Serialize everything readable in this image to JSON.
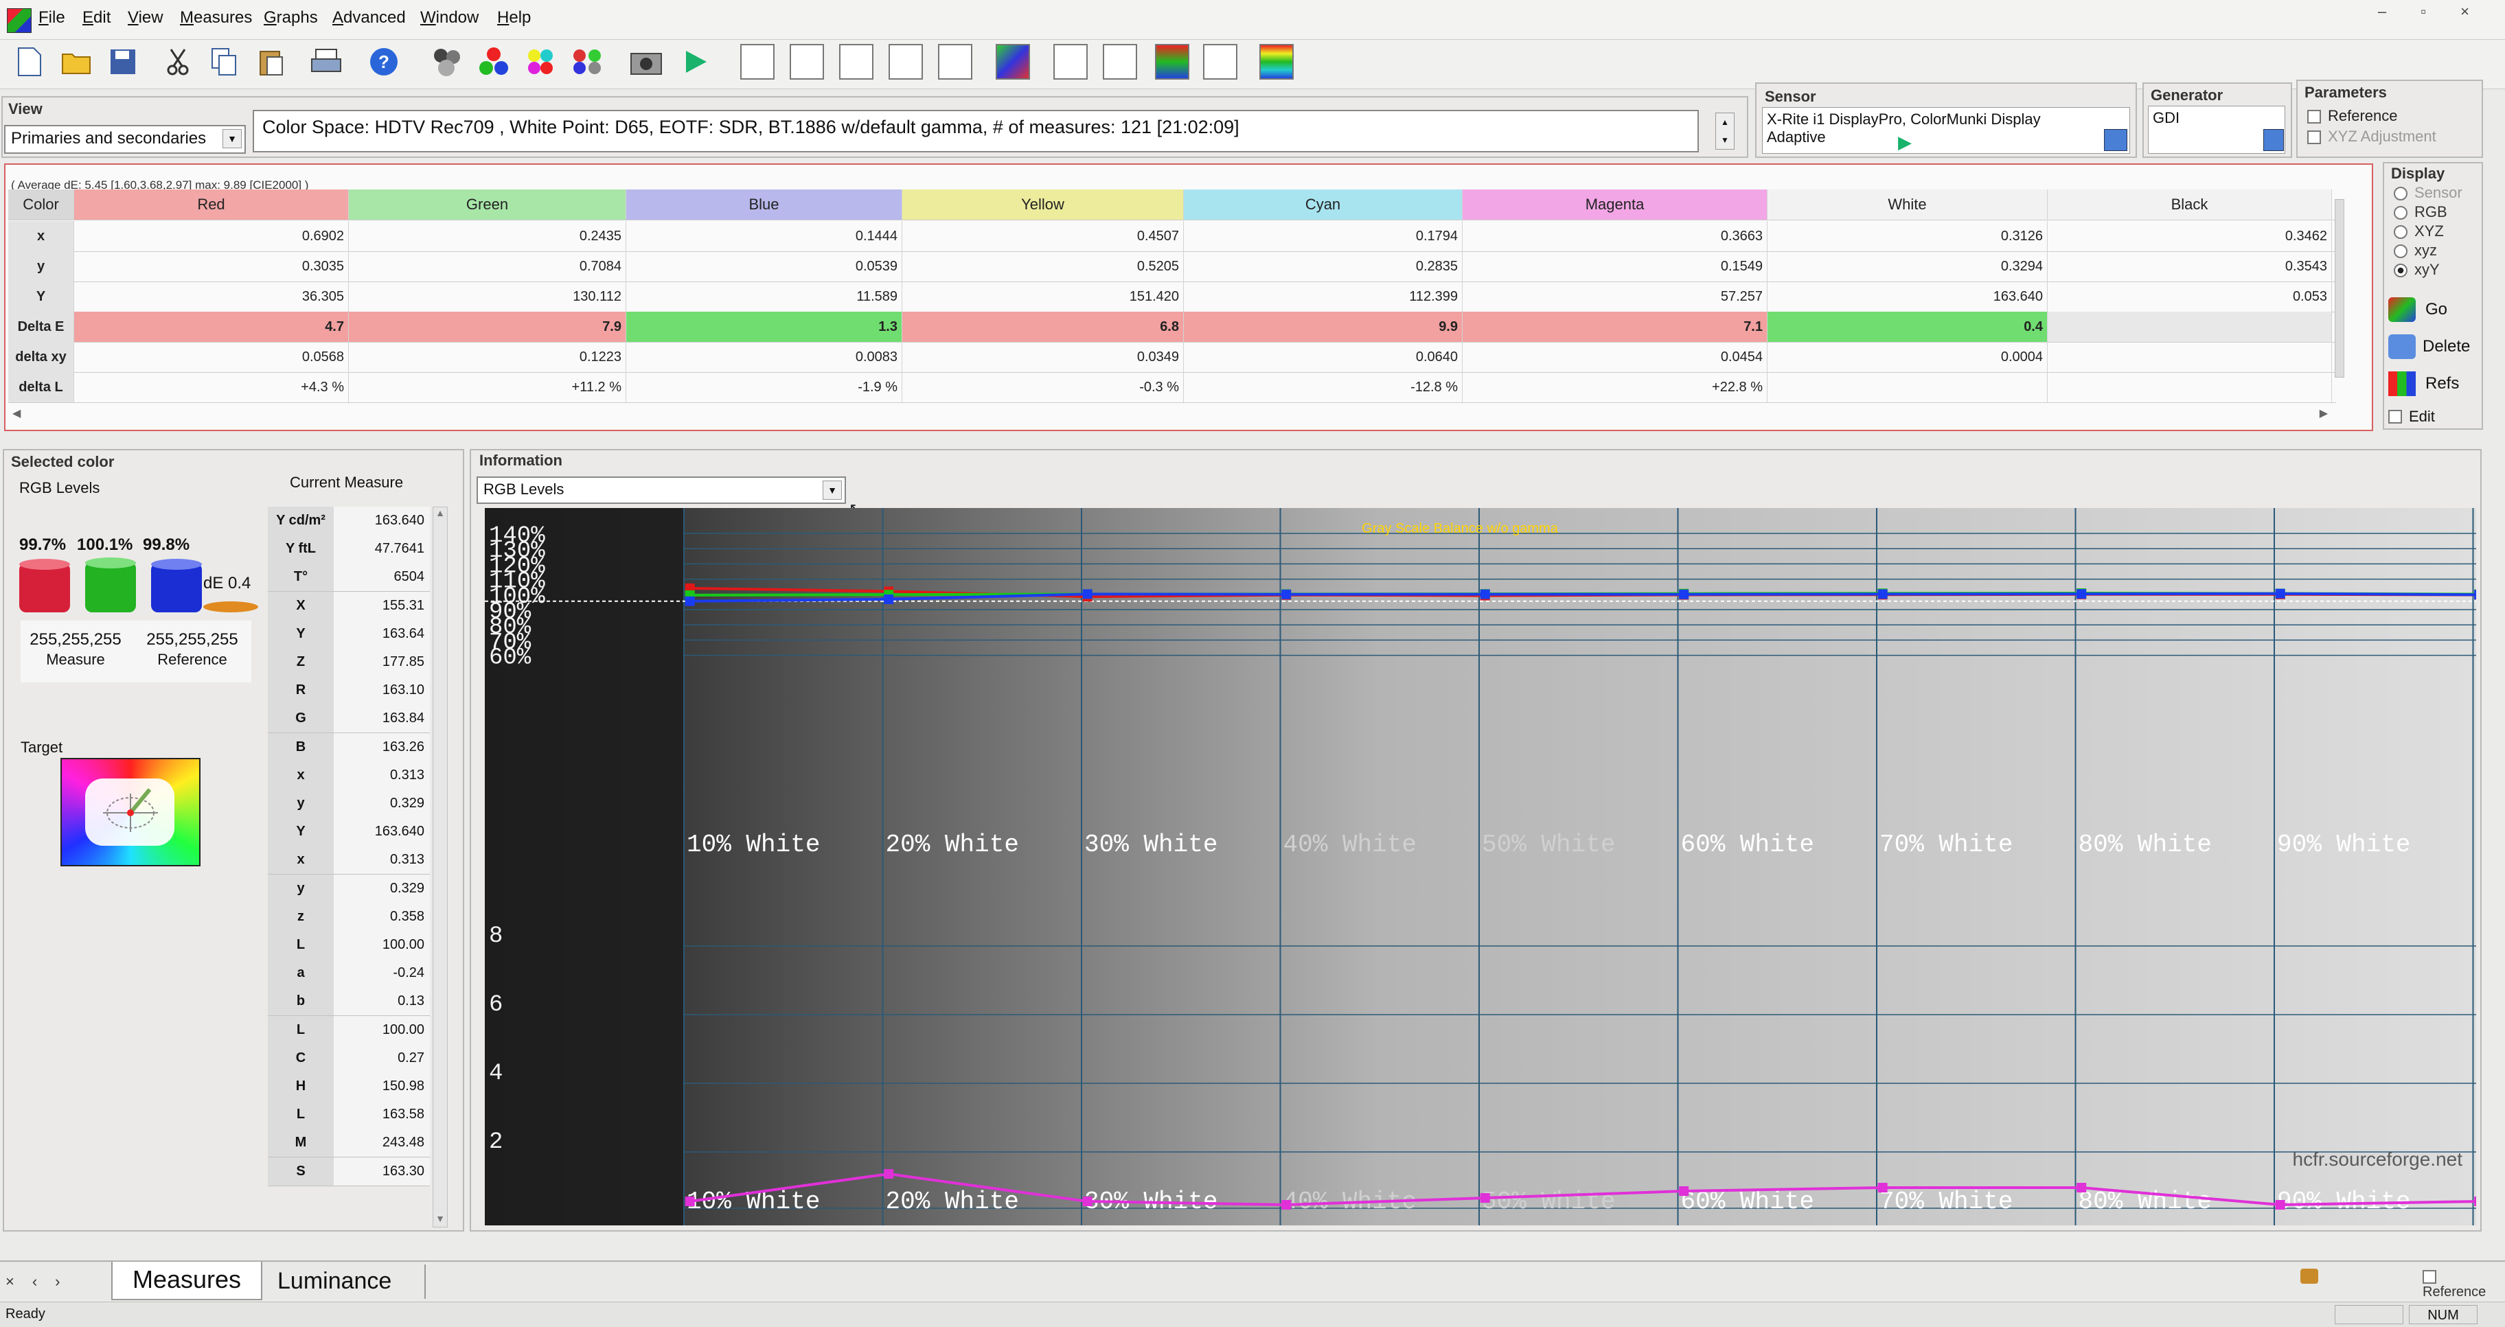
{
  "menu": [
    "File",
    "Edit",
    "View",
    "Measures",
    "Graphs",
    "Advanced",
    "Window",
    "Help"
  ],
  "view": {
    "title": "View",
    "mode": "Primaries and secondaries",
    "info": "Color Space: HDTV Rec709 , White Point: D65, EOTF:  SDR, BT.1886 w/default gamma, # of measures: 121 [21:02:09]"
  },
  "sensor": {
    "title": "Sensor",
    "device": "X-Rite i1 DisplayPro, ColorMunki Display",
    "mode": "Adaptive"
  },
  "generator": {
    "title": "Generator",
    "value": "GDI"
  },
  "parameters": {
    "title": "Parameters",
    "reference": "Reference",
    "xyz_adjust": "XYZ Adjustment"
  },
  "summary": "( Average dE: 5.45 [1.60,3.68,2.97] max: 9.89 [CIE2000] )",
  "table": {
    "header": [
      "Color",
      "Red",
      "Green",
      "Blue",
      "Yellow",
      "Cyan",
      "Magenta",
      "White",
      "Black"
    ],
    "header_colors": [
      "#d8d8d8",
      "#f2a6a6",
      "#a8e6a8",
      "#b8b8ec",
      "#ecec9c",
      "#a8e4f0",
      "#f3a6e6",
      "#f2f2f2",
      "#f2f2f2"
    ],
    "rows": [
      {
        "label": "x",
        "cells": [
          "0.6902",
          "0.2435",
          "0.1444",
          "0.4507",
          "0.1794",
          "0.3663",
          "0.3126",
          "0.3462"
        ]
      },
      {
        "label": "y",
        "cells": [
          "0.3035",
          "0.7084",
          "0.0539",
          "0.5205",
          "0.2835",
          "0.1549",
          "0.3294",
          "0.3543"
        ]
      },
      {
        "label": "Y",
        "cells": [
          "36.305",
          "130.112",
          "11.589",
          "151.420",
          "112.399",
          "57.257",
          "163.640",
          "0.053"
        ]
      },
      {
        "label": "Delta E",
        "cells": [
          "4.7",
          "7.9",
          "1.3",
          "6.8",
          "9.9",
          "7.1",
          "0.4",
          ""
        ],
        "colors": [
          "#f2a0a0",
          "#f2a0a0",
          "#70dd70",
          "#f2a0a0",
          "#f2a0a0",
          "#f2a0a0",
          "#70dd70",
          "#e8e8e8"
        ]
      },
      {
        "label": "delta xy",
        "cells": [
          "0.0568",
          "0.1223",
          "0.0083",
          "0.0349",
          "0.0640",
          "0.0454",
          "0.0004",
          ""
        ]
      },
      {
        "label": "delta L",
        "cells": [
          "+4.3 %",
          "+11.2 %",
          "-1.9 %",
          "-0.3 %",
          "-12.8 %",
          "+22.8 %",
          "",
          ""
        ]
      }
    ]
  },
  "display": {
    "title": "Display",
    "options": [
      {
        "label": "Sensor",
        "selected": false,
        "dim": true
      },
      {
        "label": "RGB",
        "selected": false,
        "dim": false
      },
      {
        "label": "XYZ",
        "selected": false,
        "dim": false
      },
      {
        "label": "xyz",
        "selected": false,
        "dim": false
      },
      {
        "label": "xyY",
        "selected": true,
        "dim": false
      }
    ],
    "go": "Go",
    "delete": "Delete",
    "refs": "Refs",
    "edit": "Edit"
  },
  "selected": {
    "title": "Selected color",
    "subtitle": "RGB Levels",
    "current_measure": "Current Measure",
    "levels": [
      "99.7%",
      "100.1%",
      "99.8%"
    ],
    "de": "dE 0.4",
    "measure_rgb": "255,255,255",
    "measure_label": "Measure",
    "reference_rgb": "255,255,255",
    "reference_label": "Reference",
    "target": "Target"
  },
  "measure_list": [
    [
      "Y cd/m²",
      "163.640"
    ],
    [
      "Y ftL",
      "47.7641"
    ],
    [
      "T°",
      "6504"
    ],
    [
      "X",
      "155.31"
    ],
    [
      "Y",
      "163.64"
    ],
    [
      "Z",
      "177.85"
    ],
    [
      "R",
      "163.10"
    ],
    [
      "G",
      "163.84"
    ],
    [
      "B",
      "163.26"
    ],
    [
      "x",
      "0.313"
    ],
    [
      "y",
      "0.329"
    ],
    [
      "Y",
      "163.640"
    ],
    [
      "x",
      "0.313"
    ],
    [
      "y",
      "0.329"
    ],
    [
      "z",
      "0.358"
    ],
    [
      "L",
      "100.00"
    ],
    [
      "a",
      "-0.24"
    ],
    [
      "b",
      "0.13"
    ],
    [
      "L",
      "100.00"
    ],
    [
      "C",
      "0.27"
    ],
    [
      "H",
      "150.98"
    ],
    [
      "L",
      "163.58"
    ],
    [
      "M",
      "243.48"
    ],
    [
      "S",
      "163.30"
    ]
  ],
  "information": {
    "title": "Information",
    "combo": "RGB Levels"
  },
  "chart_data": {
    "type": "line",
    "title": "Gray Scale Balance w/o gamma",
    "watermark": "hcfr.sourceforge.net",
    "x_labels": [
      "10% White",
      "20% White",
      "30% White",
      "40% White",
      "50% White",
      "60% White",
      "70% White",
      "80% White",
      "90% White"
    ],
    "x": [
      10,
      20,
      30,
      40,
      50,
      60,
      70,
      80,
      90,
      100
    ],
    "top_panel": {
      "y_ticks": [
        "140%",
        "130%",
        "120%",
        "110%",
        "100%",
        "90%",
        "80%",
        "70%",
        "60%"
      ],
      "ylim": [
        55,
        145
      ],
      "series": [
        {
          "name": "Red",
          "color": "#e01818",
          "values": [
            104,
            102,
            98.5,
            99.6,
            99.2,
            99.7,
            99.8,
            100,
            100,
            99.7
          ]
        },
        {
          "name": "Green",
          "color": "#18c818",
          "values": [
            99.5,
            99.8,
            100.2,
            100.2,
            100.3,
            100.5,
            100.7,
            100.8,
            100.6,
            100.1
          ]
        },
        {
          "name": "Blue",
          "color": "#1a3cf0",
          "values": [
            95.5,
            96.8,
            100.2,
            100,
            100.1,
            100,
            100.2,
            100.3,
            100.5,
            99.8
          ]
        }
      ]
    },
    "bottom_panel": {
      "y_ticks": [
        "8",
        "6",
        "4",
        "2"
      ],
      "ylim": [
        0,
        10
      ],
      "series": [
        {
          "name": "Delta E",
          "color": "#e030d8",
          "values": [
            0.2,
            1.0,
            0.2,
            0.1,
            0.3,
            0.5,
            0.6,
            0.6,
            0.1,
            0.2
          ]
        }
      ]
    }
  },
  "tabs": [
    "Measures",
    "Luminance"
  ],
  "status": {
    "ready": "Ready",
    "num": "NUM",
    "reference": "Reference"
  }
}
